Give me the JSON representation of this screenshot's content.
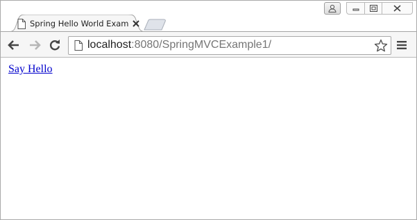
{
  "tab": {
    "title": "Spring Hello World Examp",
    "icon": "page-icon",
    "close_icon": "close-icon"
  },
  "toolbar": {
    "url_host": "localhost",
    "url_rest": ":8080/SpringMVCExample1/"
  },
  "page": {
    "link_text": "Say Hello"
  },
  "colors": {
    "link": "#0000cc",
    "toolbar_bg": "#f6f6f6"
  }
}
